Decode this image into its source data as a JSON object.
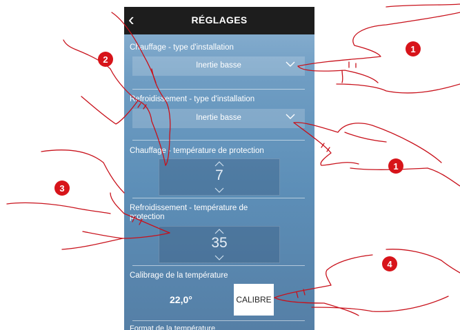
{
  "header": {
    "back_icon": "chevron-left-icon",
    "title": "RÉGLAGES"
  },
  "settings": {
    "heating_type_label": "Chauffage - type d'installation",
    "heating_type_value": "Inertie basse",
    "cooling_type_label": "Refroidissement - type d'installation",
    "cooling_type_value": "Inertie basse",
    "heating_protection_label": "Chauffage - température de protection",
    "heating_protection_value": "7",
    "cooling_protection_label_1": "Refroidissement - température de",
    "cooling_protection_label_2": "protection",
    "cooling_protection_value": "35",
    "calibration_label": "Calibrage de la température",
    "calibration_value": "22,0°",
    "calibrate_button": "CALIBRE",
    "temperature_format_label": "Format de la température"
  },
  "callouts": [
    "1",
    "2",
    "1",
    "3",
    "4"
  ],
  "colors": {
    "accent": "#d7141a",
    "topbar": "#1d1d1d"
  }
}
